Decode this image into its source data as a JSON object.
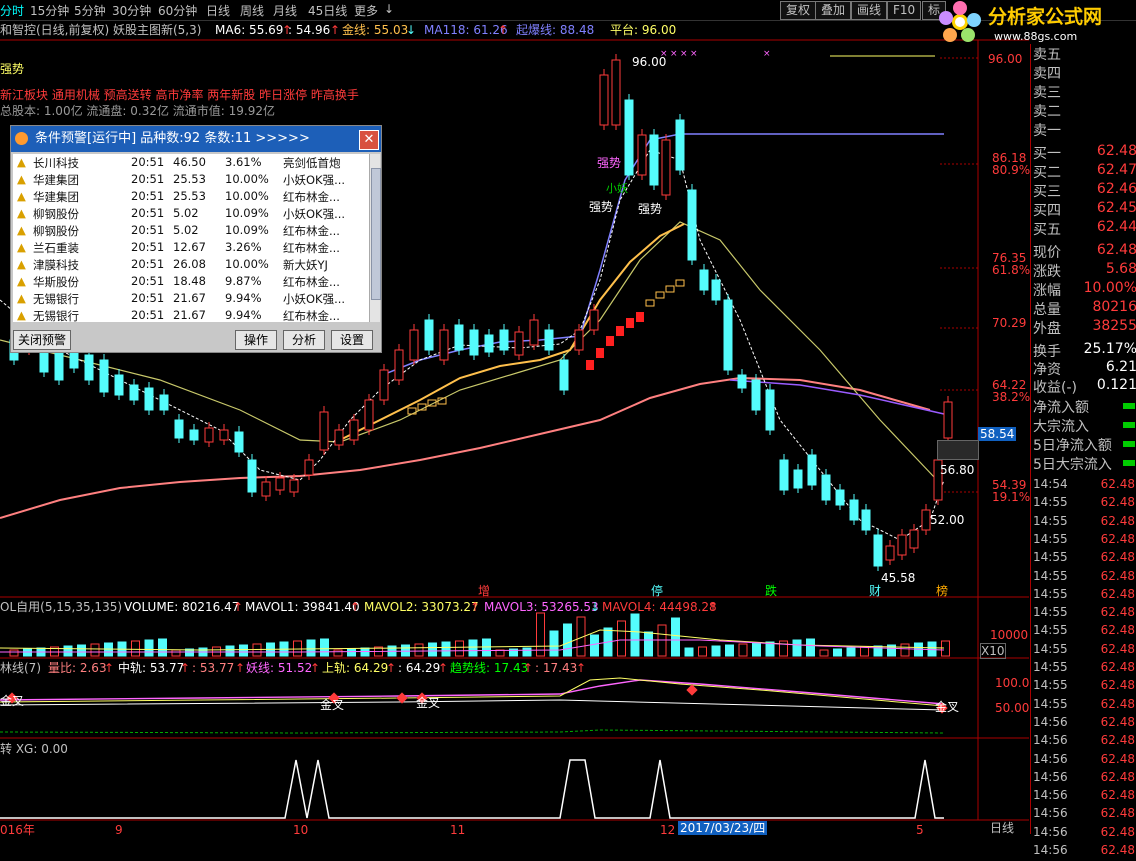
{
  "toolbar": {
    "timeframes": [
      "分时",
      "15分钟",
      "5分钟",
      "30分钟",
      "60分钟",
      "日线",
      "周线",
      "月线",
      "45日线",
      "更多"
    ],
    "active_timeframe": "分时",
    "buttons": [
      "复权",
      "叠加",
      "画线",
      "F10",
      "标"
    ]
  },
  "logo": {
    "text": "分析家公式网",
    "url": "www.88gs.com"
  },
  "indicator_line": {
    "title": "和智控(日线,前复权) 妖股主图新(5,3)",
    "ma6": "MA6: 55.69",
    "ma6b": ": 54.96",
    "jin": "金线: 55.03",
    "ma118": "MA118: 61.26",
    "qibao": "起爆线: 88.48",
    "pingtai": "平台: 96.00"
  },
  "info": {
    "strong": "强势",
    "tags": "新江板块 通用机械 预高送转 高市净率 两年新股 昨日涨停 昨高换手",
    "capital": "总股本: 1.00亿 流通盘: 0.32亿 流通市值: 19.92亿"
  },
  "chart_labels": {
    "peak": "96.00",
    "low": "45.58",
    "strong1": "强势",
    "strong2": "强势",
    "strong3": "强势",
    "xiaoyao": "小妖",
    "mark_zeng": "增",
    "mark_ting": "停",
    "mark_die": "跌",
    "mark_cai": "财",
    "mark_bang": "榜",
    "right1": "56.80",
    "right2": "52.00",
    "price_tag": "58.54"
  },
  "y_axis": [
    {
      "value": "96.00"
    },
    {
      "value": "86.18"
    },
    {
      "value": "80.9%"
    },
    {
      "value": "76.35"
    },
    {
      "value": "61.8%"
    },
    {
      "value": "70.29"
    },
    {
      "value": "64.22"
    },
    {
      "value": "38.2%"
    },
    {
      "value": "54.39"
    },
    {
      "value": "19.1%"
    }
  ],
  "alert": {
    "title": "条件预警[运行中] 品种数:92 条数:11 >>>>>",
    "close_label": "关闭预警",
    "op_label": "操作",
    "analyze_label": "分析",
    "settings_label": "设置",
    "rows": [
      {
        "name": "长川科技",
        "time": "20:51",
        "price": "46.50",
        "pct": "3.61%",
        "note": "亮剑低首炮"
      },
      {
        "name": "华建集团",
        "time": "20:51",
        "price": "25.53",
        "pct": "10.00%",
        "note": "小妖OK强..."
      },
      {
        "name": "华建集团",
        "time": "20:51",
        "price": "25.53",
        "pct": "10.00%",
        "note": "红布林金..."
      },
      {
        "name": "柳钢股份",
        "time": "20:51",
        "price": "5.02",
        "pct": "10.09%",
        "note": "小妖OK强..."
      },
      {
        "name": "柳钢股份",
        "time": "20:51",
        "price": "5.02",
        "pct": "10.09%",
        "note": "红布林金..."
      },
      {
        "name": "兰石重装",
        "time": "20:51",
        "price": "12.67",
        "pct": "3.26%",
        "note": "红布林金..."
      },
      {
        "name": "津膜科技",
        "time": "20:51",
        "price": "26.08",
        "pct": "10.00%",
        "note": "新大妖YJ"
      },
      {
        "name": "华斯股份",
        "time": "20:51",
        "price": "18.48",
        "pct": "9.87%",
        "note": "红布林金..."
      },
      {
        "name": "无锡银行",
        "time": "20:51",
        "price": "21.67",
        "pct": "9.94%",
        "note": "小妖OK强..."
      },
      {
        "name": "无锡银行",
        "time": "20:51",
        "price": "21.67",
        "pct": "9.94%",
        "note": "红布林金..."
      }
    ]
  },
  "volume": {
    "header": "OL自用(5,15,35,135)",
    "volume": "VOLUME: 80216.47",
    "mavol1": "MAVOL1: 39841.40",
    "mavol2": "MAVOL2: 33073.27",
    "mavol3": "MAVOL3: 53265.53",
    "mavol4": "MAVOL4: 44498.28",
    "scale": "10000",
    "unit": "X10"
  },
  "bollinger": {
    "header": "林线(7)",
    "liangbi": "量比: 2.63",
    "zhonggui": "中轨: 53.77",
    "zhonggui2": ": 53.77",
    "yaoxian": "妖线: 51.52",
    "shanggui": "上轨: 64.29",
    "shanggui2": ": 64.29",
    "qushi": "趋势线: 17.43",
    "qushi2": ": 17.43",
    "jincha": "金叉",
    "scale_hi": "100.0",
    "scale_lo": "50.00"
  },
  "xg": {
    "header": "转 XG: 0.00"
  },
  "x_axis": [
    {
      "label": "016年"
    },
    {
      "label": "9"
    },
    {
      "label": "10"
    },
    {
      "label": "11"
    },
    {
      "label": "12"
    },
    {
      "label": "2017/03/23/四"
    },
    {
      "label": "5"
    }
  ],
  "x_axis_right": "日线",
  "right_panel": {
    "sell": [
      {
        "label": "卖五"
      },
      {
        "label": "卖四"
      },
      {
        "label": "卖三"
      },
      {
        "label": "卖二"
      },
      {
        "label": "卖一"
      }
    ],
    "buy": [
      {
        "label": "买一",
        "value": "62.48"
      },
      {
        "label": "买二",
        "value": "62.47"
      },
      {
        "label": "买三",
        "value": "62.46"
      },
      {
        "label": "买四",
        "value": "62.45"
      },
      {
        "label": "买五",
        "value": "62.44"
      }
    ],
    "stats": [
      {
        "label": "现价",
        "value": "62.48"
      },
      {
        "label": "涨跌",
        "value": "5.68"
      },
      {
        "label": "涨幅",
        "value": "10.00%"
      },
      {
        "label": "总量",
        "value": "80216"
      },
      {
        "label": "外盘",
        "value": "38255"
      }
    ],
    "stats2": [
      {
        "label": "换手",
        "value": "25.17%"
      },
      {
        "label": "净资",
        "value": "6.21"
      },
      {
        "label": "收益(-)",
        "value": "0.121"
      }
    ],
    "flows": [
      {
        "label": "净流入额"
      },
      {
        "label": "大宗流入"
      },
      {
        "label": "5日净流入额"
      },
      {
        "label": "5日大宗流入"
      }
    ],
    "ticks": [
      {
        "time": "14:54",
        "price": "62.48"
      },
      {
        "time": "14:55",
        "price": "62.48"
      },
      {
        "time": "14:55",
        "price": "62.48"
      },
      {
        "time": "14:55",
        "price": "62.48"
      },
      {
        "time": "14:55",
        "price": "62.48"
      },
      {
        "time": "14:55",
        "price": "62.48"
      },
      {
        "time": "14:55",
        "price": "62.48"
      },
      {
        "time": "14:55",
        "price": "62.48"
      },
      {
        "time": "14:55",
        "price": "62.48"
      },
      {
        "time": "14:55",
        "price": "62.48"
      },
      {
        "time": "14:55",
        "price": "62.48"
      },
      {
        "time": "14:55",
        "price": "62.48"
      },
      {
        "time": "14:55",
        "price": "62.48"
      },
      {
        "time": "14:56",
        "price": "62.48"
      },
      {
        "time": "14:56",
        "price": "62.48"
      },
      {
        "time": "14:56",
        "price": "62.48"
      },
      {
        "time": "14:56",
        "price": "62.48"
      },
      {
        "time": "14:56",
        "price": "62.48"
      },
      {
        "time": "14:56",
        "price": "62.48"
      },
      {
        "time": "14:56",
        "price": "62.48"
      },
      {
        "time": "14:56",
        "price": "62.48"
      }
    ]
  },
  "colors": {
    "up": "#ff3b3b",
    "down": "#54fcfc",
    "ma_yellow": "#ffc04c",
    "ma_pink": "#ff8080",
    "ma_blue": "#8080ff",
    "green": "#00cc00"
  }
}
